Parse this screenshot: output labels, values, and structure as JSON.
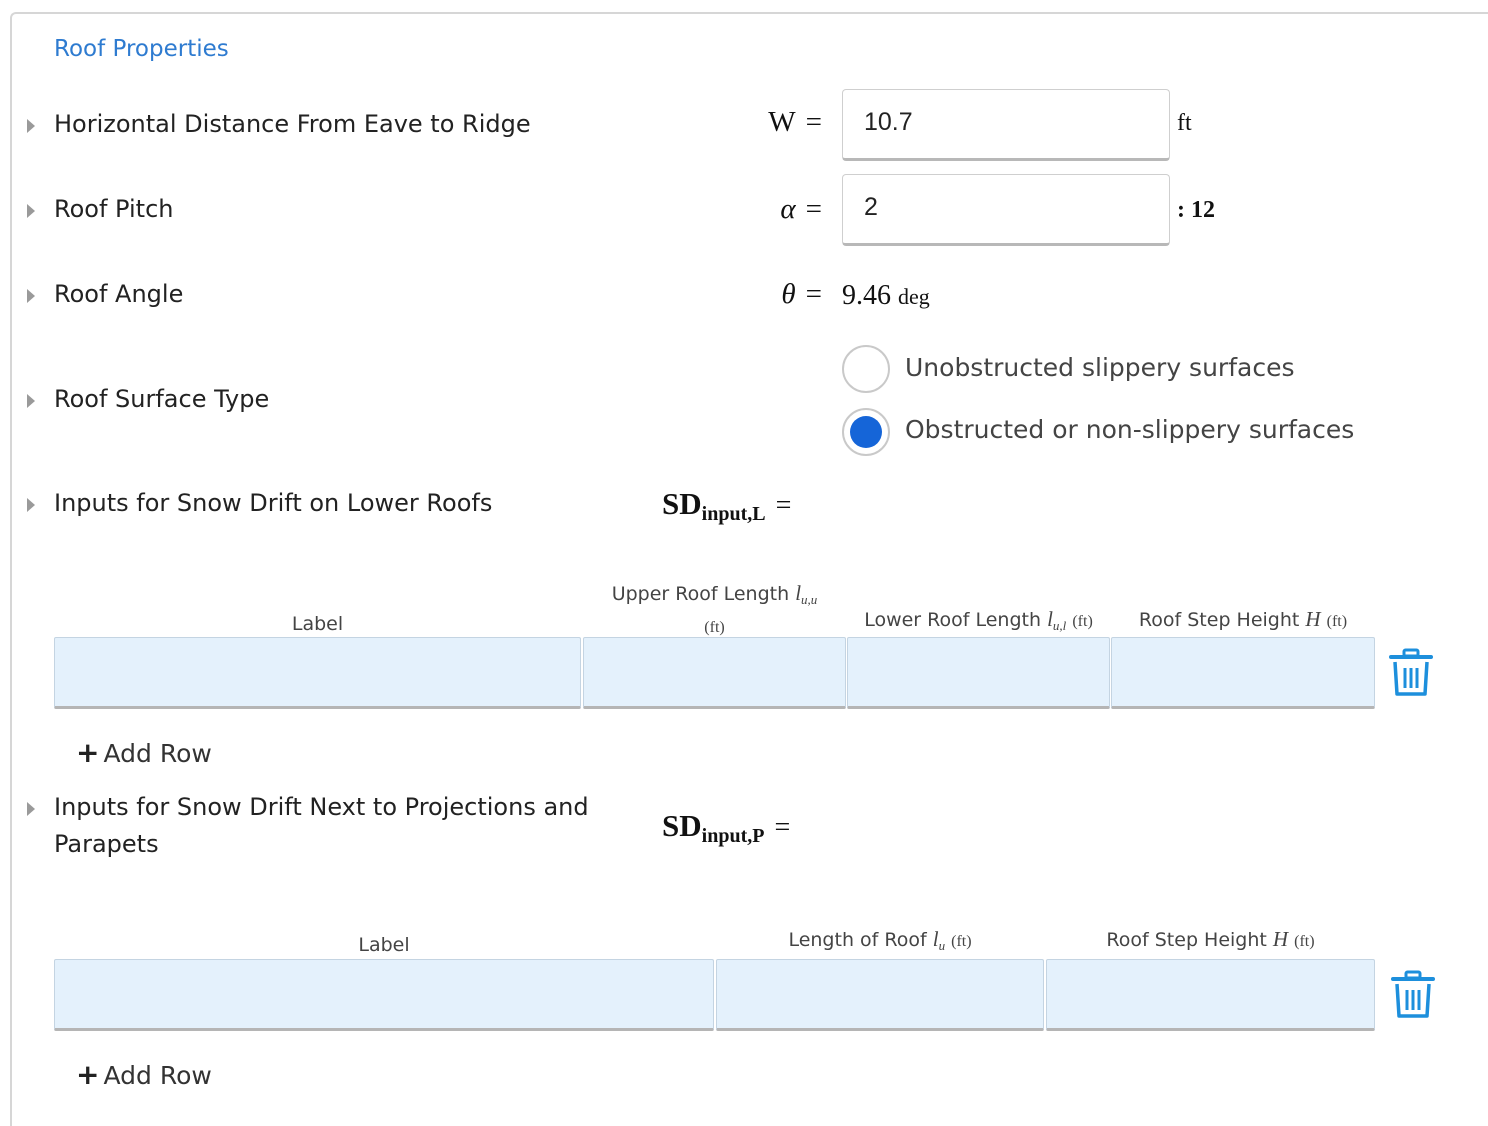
{
  "section_title": "Roof Properties",
  "rows": {
    "eave_to_ridge": {
      "label": "Horizontal Distance From Eave to Ridge",
      "symbol": "W",
      "equals": "=",
      "value": "10.7",
      "unit": "ft"
    },
    "pitch": {
      "label": "Roof Pitch",
      "symbol": "α",
      "equals": "=",
      "value": "2",
      "unit": ": 12"
    },
    "angle": {
      "label": "Roof Angle",
      "symbol": "θ",
      "equals": "=",
      "value": "9.46",
      "unit": "deg"
    },
    "surface": {
      "label": "Roof Surface Type",
      "options": [
        {
          "label": "Unobstructed slippery surfaces",
          "selected": false
        },
        {
          "label": "Obstructed or non-slippery surfaces",
          "selected": true
        }
      ]
    }
  },
  "lower_roofs": {
    "label": "Inputs for Snow Drift on Lower Roofs",
    "symbol_main": "SD",
    "symbol_sub": "input,L",
    "equals": "=",
    "columns": [
      {
        "text": "Label"
      },
      {
        "text": "Upper Roof Length",
        "var": "l",
        "var_sub": "u,u",
        "unit": "(ft)"
      },
      {
        "text": "Lower Roof Length",
        "var": "l",
        "var_sub": "u,l",
        "unit": "(ft)"
      },
      {
        "text": "Roof Step Height",
        "var": "H",
        "unit": "(ft)"
      }
    ],
    "add_row_label": "Add Row"
  },
  "projections": {
    "label_line1": "Inputs for Snow Drift Next to Projections and",
    "label_line2": "Parapets",
    "symbol_main": "SD",
    "symbol_sub": "input,P",
    "equals": "=",
    "columns": [
      {
        "text": "Label"
      },
      {
        "text": "Length of Roof",
        "var": "l",
        "var_sub": "u",
        "unit": "(ft)"
      },
      {
        "text": "Roof Step Height",
        "var": "H",
        "unit": "(ft)"
      }
    ],
    "add_row_label": "Add Row"
  },
  "icons": {
    "caret": "caret-right-icon",
    "trash": "trash-icon",
    "plus": "plus-icon"
  },
  "colors": {
    "accent": "#2e7bd0",
    "radio_selected": "#1565d8",
    "cell_bg": "#e4f1fc"
  }
}
